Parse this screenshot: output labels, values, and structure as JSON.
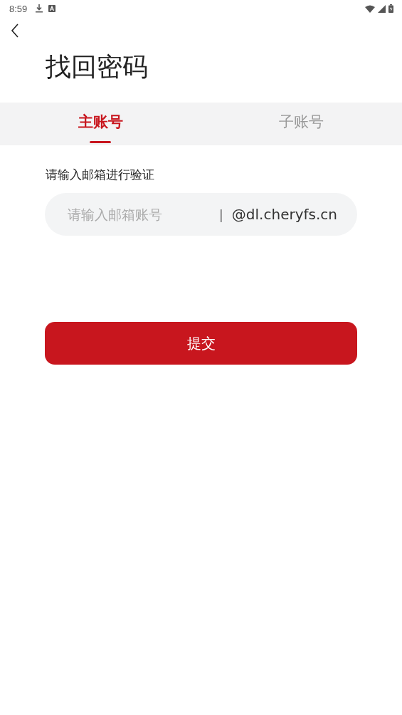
{
  "status_bar": {
    "time": "8:59"
  },
  "title": "找回密码",
  "tabs": [
    {
      "label": "主账号",
      "selected": true
    },
    {
      "label": "子账号",
      "selected": false
    }
  ],
  "form": {
    "label": "请输入邮箱进行验证",
    "placeholder": "请输入邮箱账号",
    "separator": "|",
    "suffix": "@dl.cheryfs.cn"
  },
  "submit_button": "提交"
}
